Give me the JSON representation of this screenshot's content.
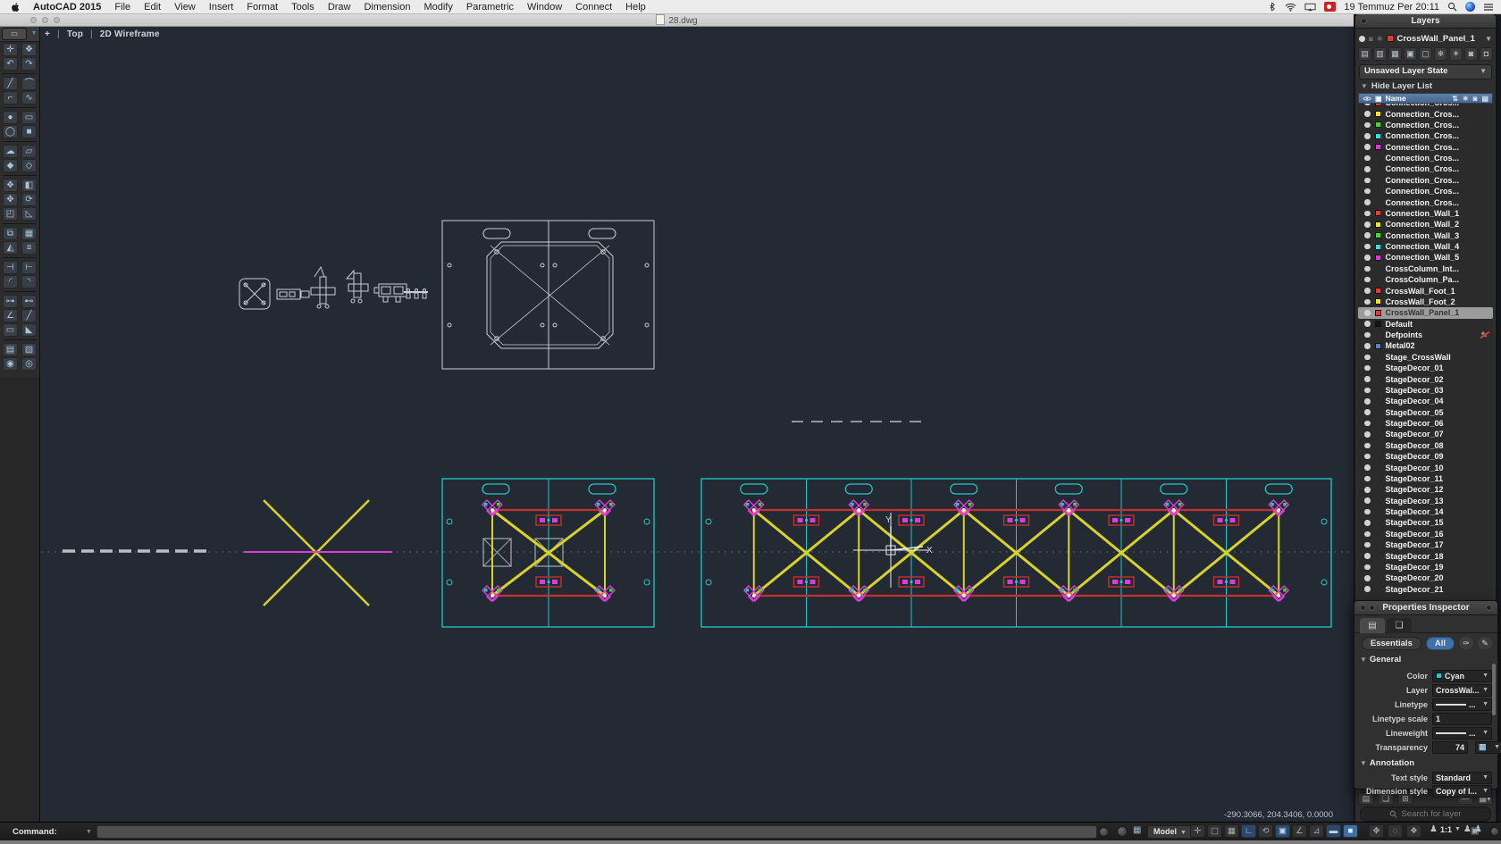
{
  "menu_bar": {
    "app_name": "AutoCAD 2015",
    "items": [
      "File",
      "Edit",
      "View",
      "Insert",
      "Format",
      "Tools",
      "Draw",
      "Dimension",
      "Modify",
      "Parametric",
      "Window",
      "Connect",
      "Help"
    ],
    "clock": "19 Temmuz Per 20:11"
  },
  "title_bar": {
    "document": "28.dwg"
  },
  "viewport": {
    "add_control": "+",
    "view_name": "Top",
    "visual_style": "2D Wireframe",
    "cursor_axis_y": "Y",
    "cursor_axis_x": "X",
    "coordinates": "-290.3066, 204.3406, 0.0000"
  },
  "toolbar": {
    "rows": [
      {
        "icons": [
          {
            "name": "object-snap-icon",
            "glyph": "✛"
          },
          {
            "name": "pan-realtime-icon",
            "glyph": "❖"
          }
        ]
      },
      {
        "icons": [
          {
            "name": "undo-icon",
            "glyph": "↶"
          },
          {
            "name": "redo-icon",
            "glyph": "↷"
          }
        ],
        "sep": true
      },
      {
        "icons": [
          {
            "name": "line-icon",
            "glyph": "╱"
          },
          {
            "name": "arc-icon",
            "glyph": "⌒"
          }
        ]
      },
      {
        "icons": [
          {
            "name": "polyline-icon",
            "glyph": "⌐"
          },
          {
            "name": "spline-icon",
            "glyph": "∿"
          }
        ],
        "sep": true
      },
      {
        "icons": [
          {
            "name": "circle-icon",
            "glyph": "●"
          },
          {
            "name": "rectangle-icon",
            "glyph": "▭"
          }
        ]
      },
      {
        "icons": [
          {
            "name": "ellipse-icon",
            "glyph": "◯"
          },
          {
            "name": "region-icon",
            "glyph": "■"
          }
        ],
        "sep": true
      },
      {
        "icons": [
          {
            "name": "revision-cloud-icon",
            "glyph": "☁"
          },
          {
            "name": "wipeout-icon",
            "glyph": "▱"
          }
        ]
      },
      {
        "icons": [
          {
            "name": "point-icon",
            "glyph": "◆"
          },
          {
            "name": "multipoint-icon",
            "glyph": "◇"
          }
        ],
        "sep": true
      },
      {
        "icons": [
          {
            "name": "union-icon",
            "glyph": "❖"
          },
          {
            "name": "subtract-icon",
            "glyph": "◧"
          }
        ]
      },
      {
        "icons": [
          {
            "name": "move-icon",
            "glyph": "✥"
          },
          {
            "name": "rotate-icon",
            "glyph": "⟳"
          }
        ]
      },
      {
        "icons": [
          {
            "name": "scale-icon",
            "glyph": "◰"
          },
          {
            "name": "chamfer-icon",
            "glyph": "◺"
          }
        ],
        "sep": true
      },
      {
        "icons": [
          {
            "name": "copy-icon",
            "glyph": "⧉"
          },
          {
            "name": "array-icon",
            "glyph": "▦"
          }
        ]
      },
      {
        "icons": [
          {
            "name": "mirror-icon",
            "glyph": "◭"
          },
          {
            "name": "offset-icon",
            "glyph": "≡"
          }
        ],
        "sep": true
      },
      {
        "icons": [
          {
            "name": "trim-icon",
            "glyph": "⊣"
          },
          {
            "name": "extend-icon",
            "glyph": "⊢"
          }
        ]
      },
      {
        "icons": [
          {
            "name": "fillet-icon",
            "glyph": "◜"
          },
          {
            "name": "blend-icon",
            "glyph": "◝"
          }
        ],
        "sep": true
      },
      {
        "icons": [
          {
            "name": "stretch-icon",
            "glyph": "⊶"
          },
          {
            "name": "lengthen-icon",
            "glyph": "⊷"
          }
        ]
      },
      {
        "icons": [
          {
            "name": "measure-icon",
            "glyph": "∠"
          },
          {
            "name": "divide-icon",
            "glyph": "╱"
          }
        ]
      },
      {
        "icons": [
          {
            "name": "break-icon",
            "glyph": "▭"
          },
          {
            "name": "join-icon",
            "glyph": "◣"
          }
        ],
        "sep": true
      },
      {
        "icons": [
          {
            "name": "hatch-icon",
            "glyph": "▤"
          },
          {
            "name": "gradient-icon",
            "glyph": "▧"
          }
        ]
      },
      {
        "icons": [
          {
            "name": "donut-icon",
            "glyph": "◉"
          },
          {
            "name": "helix-icon",
            "glyph": "◎"
          }
        ]
      }
    ]
  },
  "layers_panel": {
    "title": "Layers",
    "current_layer": "CrossWall_Panel_1",
    "current_swatch": "#e8392a",
    "layer_state": "Unsaved Layer State",
    "hide_list_label": "Hide Layer List",
    "name_header": "Name",
    "header_icons": [
      {
        "name": "new-layer-icon",
        "glyph": "▤"
      },
      {
        "name": "delete-layer-icon",
        "glyph": "▥"
      },
      {
        "name": "layer-settings-icon",
        "glyph": "▦"
      },
      {
        "name": "isolate-layer-icon",
        "glyph": "▣"
      },
      {
        "name": "unisolate-layer-icon",
        "glyph": "▢"
      },
      {
        "name": "freeze-layer-icon",
        "glyph": "❄"
      },
      {
        "name": "thaw-layer-icon",
        "glyph": "☀"
      },
      {
        "name": "lock-layer-icon",
        "glyph": "◙"
      },
      {
        "name": "unlock-layer-icon",
        "glyph": "◘"
      }
    ],
    "column_icons": [
      {
        "name": "sort-icon",
        "glyph": "⇅"
      },
      {
        "name": "freeze-column-icon",
        "glyph": "✳"
      },
      {
        "name": "lock-column-icon",
        "glyph": "◙"
      },
      {
        "name": "print-column-icon",
        "glyph": "▤"
      }
    ],
    "rows": [
      {
        "name": "Connection_Cros...",
        "swatch": "#e8392a"
      },
      {
        "name": "Connection_Cros...",
        "swatch": "#f0e32b"
      },
      {
        "name": "Connection_Cros...",
        "swatch": "#3ddb2e"
      },
      {
        "name": "Connection_Cros...",
        "swatch": "#35e0e0"
      },
      {
        "name": "Connection_Cros...",
        "swatch": "#e036d8"
      },
      {
        "name": "Connection_Cros...",
        "swatch": null
      },
      {
        "name": "Connection_Cros...",
        "swatch": null
      },
      {
        "name": "Connection_Cros...",
        "swatch": null
      },
      {
        "name": "Connection_Cros...",
        "swatch": null
      },
      {
        "name": "Connection_Cros...",
        "swatch": null
      },
      {
        "name": "Connection_Wall_1",
        "swatch": "#e8392a"
      },
      {
        "name": "Connection_Wall_2",
        "swatch": "#f0e32b"
      },
      {
        "name": "Connection_Wall_3",
        "swatch": "#3ddb2e"
      },
      {
        "name": "Connection_Wall_4",
        "swatch": "#35e0e0"
      },
      {
        "name": "Connection_Wall_5",
        "swatch": "#e036d8"
      },
      {
        "name": "CrossColumn_Int...",
        "swatch": null
      },
      {
        "name": "CrossColumn_Pa...",
        "swatch": null
      },
      {
        "name": "CrossWall_Foot_1",
        "swatch": "#e8392a"
      },
      {
        "name": "CrossWall_Foot_2",
        "swatch": "#f0e32b"
      },
      {
        "name": "CrossWall_Panel_1",
        "swatch": "#e8392a",
        "selected": true
      },
      {
        "name": "Default",
        "swatch": "#161616"
      },
      {
        "name": "Defpoints",
        "swatch": null,
        "noprint": true
      },
      {
        "name": "Metal02",
        "swatch": "#5e81b5"
      },
      {
        "name": "Stage_CrossWall",
        "swatch": null
      },
      {
        "name": "StageDecor_01",
        "swatch": null
      },
      {
        "name": "StageDecor_02",
        "swatch": null
      },
      {
        "name": "StageDecor_03",
        "swatch": null
      },
      {
        "name": "StageDecor_04",
        "swatch": null
      },
      {
        "name": "StageDecor_05",
        "swatch": null
      },
      {
        "name": "StageDecor_06",
        "swatch": null
      },
      {
        "name": "StageDecor_07",
        "swatch": null
      },
      {
        "name": "StageDecor_08",
        "swatch": null
      },
      {
        "name": "StageDecor_09",
        "swatch": null
      },
      {
        "name": "StageDecor_10",
        "swatch": null
      },
      {
        "name": "StageDecor_11",
        "swatch": null
      },
      {
        "name": "StageDecor_12",
        "swatch": null
      },
      {
        "name": "StageDecor_13",
        "swatch": null
      },
      {
        "name": "StageDecor_14",
        "swatch": null
      },
      {
        "name": "StageDecor_15",
        "swatch": null
      },
      {
        "name": "StageDecor_16",
        "swatch": null
      },
      {
        "name": "StageDecor_17",
        "swatch": null
      },
      {
        "name": "StageDecor_18",
        "swatch": null
      },
      {
        "name": "StageDecor_19",
        "swatch": null
      },
      {
        "name": "StageDecor_20",
        "swatch": null
      },
      {
        "name": "StageDecor_21",
        "swatch": null
      }
    ],
    "footer_icons": [
      {
        "name": "new-layer-footer-icon",
        "glyph": "▤"
      },
      {
        "name": "new-group-icon",
        "glyph": "❏"
      },
      {
        "name": "new-group-filter-icon",
        "glyph": "⊞"
      }
    ],
    "footer_right_icons": [
      {
        "name": "remove-layer-icon",
        "glyph": "—"
      },
      {
        "name": "list-view-icon",
        "glyph": "▦▾"
      }
    ],
    "search_placeholder": "Search for layer"
  },
  "properties_panel": {
    "title": "Properties Inspector",
    "tabs": [
      {
        "name": "tab-properties",
        "glyph": "▤"
      },
      {
        "name": "tab-quick-select",
        "glyph": "❏"
      }
    ],
    "segment_essentials": "Essentials",
    "segment_all": "All",
    "right_icons": [
      {
        "name": "match-properties-icon",
        "glyph": "✑"
      },
      {
        "name": "edit-properties-icon",
        "glyph": "✎"
      }
    ],
    "section_general": "General",
    "section_annotation": "Annotation",
    "fields": {
      "color_label": "Color",
      "color_value": "Cyan",
      "layer_label": "Layer",
      "layer_value": "CrossWal...",
      "linetype_label": "Linetype",
      "linetype_value": "...",
      "ltscale_label": "Linetype scale",
      "ltscale_value": "1",
      "lineweight_label": "Lineweight",
      "lineweight_value": "...",
      "transparency_label": "Transparency",
      "transparency_value": "74",
      "textstyle_label": "Text style",
      "textstyle_value": "Standard",
      "dimstyle_label": "Dimension style",
      "dimstyle_value": "Copy of I..."
    }
  },
  "status_bar": {
    "command_label": "Command:",
    "model_label": "Model",
    "grid_glyph": "▦",
    "toggles": [
      {
        "name": "snap-toggle",
        "glyph": "✛",
        "lit": false
      },
      {
        "name": "grid-display-toggle",
        "glyph": "▢",
        "lit": false
      },
      {
        "name": "grid-toggle",
        "glyph": "▦",
        "lit": false
      },
      {
        "name": "ortho-toggle",
        "glyph": "∟",
        "lit": true
      },
      {
        "name": "polar-toggle",
        "glyph": "⟲",
        "lit": false
      },
      {
        "name": "osnap-toggle",
        "glyph": "▣",
        "lit": true
      },
      {
        "name": "angle-toggle",
        "glyph": "∠",
        "lit": false
      },
      {
        "name": "otrack-toggle",
        "glyph": "⊿",
        "lit": false
      },
      {
        "name": "lineweight-toggle",
        "glyph": "▬",
        "lit": true
      },
      {
        "name": "transparency-toggle",
        "glyph": "■",
        "lit": true,
        "fill": true
      }
    ],
    "nav_icons": [
      {
        "name": "pan-icon",
        "glyph": "✥"
      },
      {
        "name": "zoom-icon",
        "glyph": "◌"
      },
      {
        "name": "orbit-icon",
        "glyph": "❖"
      }
    ],
    "annotation_scale": "1:1",
    "annotation_icons": [
      {
        "name": "annotation-visibility-icon",
        "glyph": "♟"
      },
      {
        "name": "annotation-autoscale-icon",
        "glyph": "♟"
      }
    ],
    "screen_icon_glyph": "▣",
    "status_circle_glyph": ""
  },
  "colors": {
    "canvas_bg": "#232a33",
    "cyan": "#23c7c9",
    "yellow": "#d9d421",
    "red": "#c6302c",
    "magenta": "#dd3cdd",
    "wire": "#c9ced3",
    "accent_blue": "#3f72a8"
  }
}
